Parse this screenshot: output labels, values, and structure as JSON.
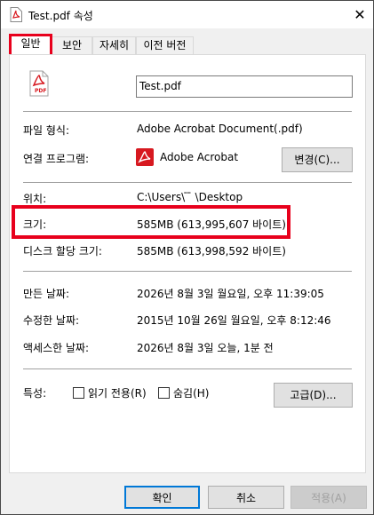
{
  "window": {
    "title": "Test.pdf 속성",
    "close_label": "✕"
  },
  "tabs": [
    {
      "label": "일반",
      "active": true
    },
    {
      "label": "보안",
      "active": false
    },
    {
      "label": "자세히",
      "active": false
    },
    {
      "label": "이전 버전",
      "active": false
    }
  ],
  "general": {
    "filename": "Test.pdf",
    "file_type_label": "파일 형식:",
    "file_type_value": "Adobe Acrobat Document(.pdf)",
    "opens_with_label": "연결 프로그램:",
    "opens_with_value": "Adobe Acrobat",
    "change_button": "변경(C)...",
    "location_label": "위치:",
    "location_value": "C:\\Users\\  ̄ ̄ \\Desktop",
    "size_label": "크기:",
    "size_value": "585MB (613,995,607 바이트)",
    "size_on_disk_label": "디스크 할당 크기:",
    "size_on_disk_value": "585MB (613,998,592 바이트)",
    "created_label": "만든 날짜:",
    "created_value": "2026년 8월 3일 월요일, 오후 11:39:05",
    "modified_label": "수정한 날짜:",
    "modified_value": "2015년 10월 26일 월요일, 오후 8:12:46",
    "accessed_label": "액세스한 날짜:",
    "accessed_value": "2026년 8월 3일 오늘, 1분 전",
    "attributes_label": "특성:",
    "readonly_label": "읽기 전용(R)",
    "hidden_label": "숨김(H)",
    "advanced_button": "고급(D)..."
  },
  "footer": {
    "ok": "확인",
    "cancel": "취소",
    "apply": "적용(A)"
  },
  "colors": {
    "highlight": "#e8001c",
    "pdf_red": "#d71920",
    "focus_blue": "#0078d7"
  }
}
